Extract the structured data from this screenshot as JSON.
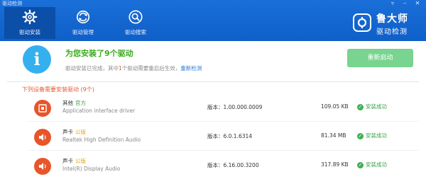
{
  "window": {
    "title": "驱动检测"
  },
  "nav": [
    {
      "label": "驱动安装",
      "icon": "gear-icon"
    },
    {
      "label": "驱动管理",
      "icon": "refresh-icon"
    },
    {
      "label": "驱动搜索",
      "icon": "search-icon"
    }
  ],
  "brand": {
    "name": "鲁大师",
    "subtitle": "驱动检测"
  },
  "summary": {
    "title": "为您安装了9个驱动",
    "desc_prefix": "驱动安装已完成，其中",
    "desc_count": "1",
    "desc_suffix": "个驱动需要重启后生效",
    "recheck_link": "重新检测",
    "restart_button": "重新启动"
  },
  "section_title": "下列设备需要安装驱动 (9个)",
  "drivers": [
    {
      "category": "其他",
      "tag": "官方",
      "name": "Application interface driver",
      "version_label": "版本：",
      "version": "1.00.000.0009",
      "size": "109.05 KB",
      "status": "安装成功"
    },
    {
      "category": "声卡",
      "tag": "公版",
      "name": "Realtek High Definition Audio",
      "version_label": "版本：",
      "version": "6.0.1.6314",
      "size": "81.34 MB",
      "status": "安装成功"
    },
    {
      "category": "声卡",
      "tag": "公版",
      "name": "Intel(R) Display Audio",
      "version_label": "版本：",
      "version": "6.16.00.3200",
      "size": "317.89 KB",
      "status": "安装成功"
    }
  ],
  "colors": {
    "header": "#1365d0",
    "nav_active": "#0c4fa8",
    "success": "#3aa14a",
    "accent_red": "#e4572e",
    "restart": "#78d48e"
  }
}
